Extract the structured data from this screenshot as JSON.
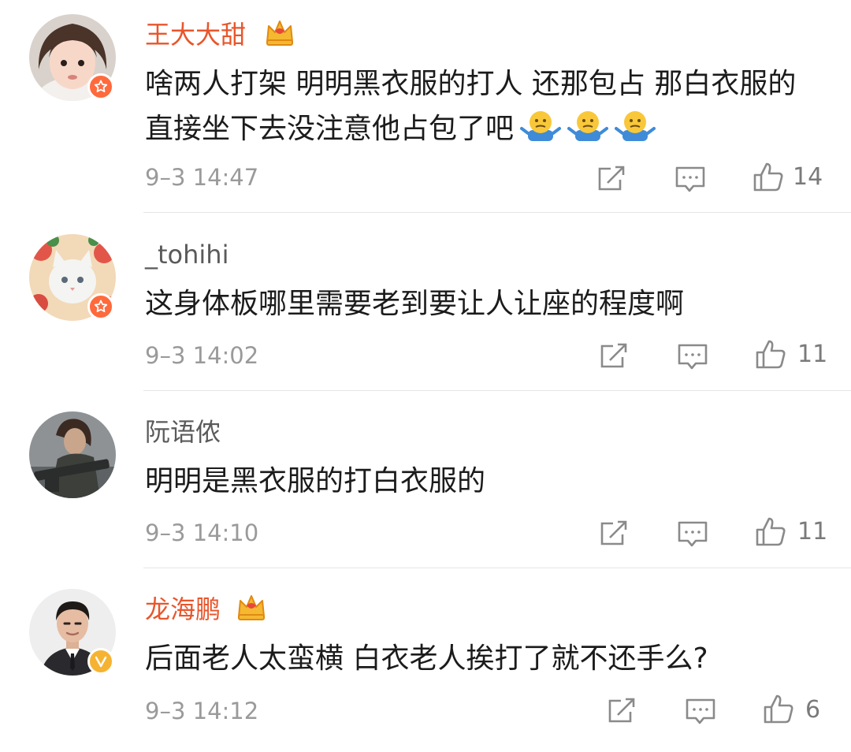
{
  "colors": {
    "vip_name": "#e8562c",
    "regular_name": "#5a5a5a",
    "star_badge": "#ff6a3d",
    "verified_badge": "#f6b332"
  },
  "comments": [
    {
      "username": "王大大甜",
      "vip": true,
      "badge": "star-badge",
      "avatar": "girl-avatar",
      "text": "啥两人打架 明明黑衣服的打人 还那包占 那白衣服的直接坐下去没注意他占包了吧",
      "emoji": [
        "shrug-emoji",
        "shrug-emoji",
        "shrug-emoji"
      ],
      "time": "9–3 14:47",
      "likes": "14"
    },
    {
      "username": "_tohihi",
      "vip": false,
      "badge": "star-badge",
      "avatar": "cat-avatar",
      "text": "这身体板哪里需要老到要让人让座的程度啊",
      "emoji": [],
      "time": "9–3 14:02",
      "likes": "11"
    },
    {
      "username": "阮语侬",
      "vip": false,
      "badge": "",
      "avatar": "soldier-avatar",
      "text": "明明是黑衣服的打白衣服的",
      "emoji": [],
      "time": "9–3 14:10",
      "likes": "11"
    },
    {
      "username": "龙海鹏",
      "vip": true,
      "badge": "verified-badge",
      "avatar": "man-avatar",
      "text": "后面老人太蛮横 白衣老人挨打了就不还手么?",
      "emoji": [],
      "time": "9–3 14:12",
      "likes": "6"
    }
  ]
}
